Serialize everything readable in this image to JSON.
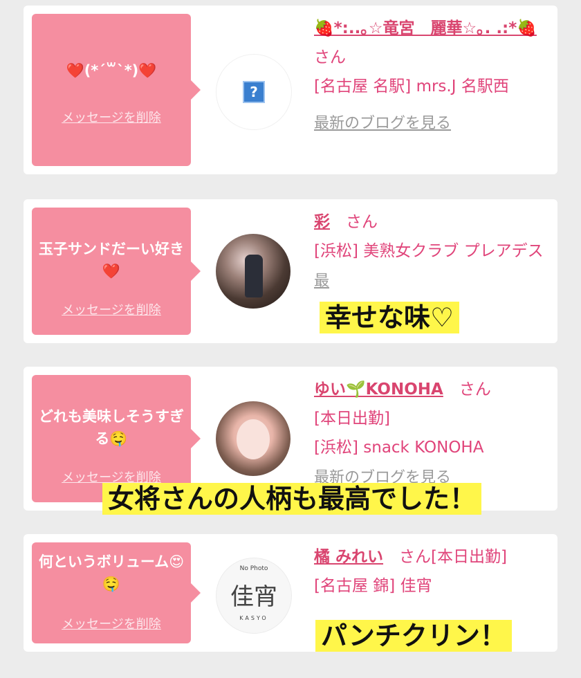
{
  "cards": [
    {
      "bubble_text": "❤️(*´꒳`*)❤️",
      "delete_label": "メッセージを削除",
      "name": "🍓*:..｡☆竜宮　麗華☆｡. .:*🍓",
      "suffix": "さん",
      "shop": "[名古屋 名駅] mrs.J 名駅西",
      "blog": "最新のブログを見る",
      "avatar_placeholder": "?"
    },
    {
      "bubble_text": "玉子サンドだーい好き❤️",
      "delete_label": "メッセージを削除",
      "name": "彩",
      "suffix": "さん",
      "shop": "[浜松] 美熟女クラブ プレアデス",
      "blog": "最"
    },
    {
      "bubble_text": "どれも美味しそうすぎる🤤",
      "delete_label": "メッセージを削除",
      "name": "ゆい🌱KONOHA",
      "suffix": "さん",
      "status": "[本日出勤]",
      "shop": "[浜松] snack KONOHA",
      "blog": "最新のブログを見る"
    },
    {
      "bubble_text": "何というボリューム😍🤤",
      "delete_label": "メッセージを削除",
      "name": "橘 みれい",
      "suffix": "さん[本日出勤]",
      "shop": "[名古屋 錦] 佳宵",
      "avatar_logo_top": "No Photo",
      "avatar_logo_main": "佳宵",
      "avatar_logo_bottom": "KASYO"
    }
  ],
  "captions": {
    "c1": "幸せな味♡",
    "c2": "女将さんの人柄も最高でした！",
    "c3": "パンチクリン！"
  },
  "colors": {
    "bubble": "#f58ea0",
    "name": "#d9456f",
    "caption_bg": "#fff64a",
    "background": "#ececec"
  }
}
